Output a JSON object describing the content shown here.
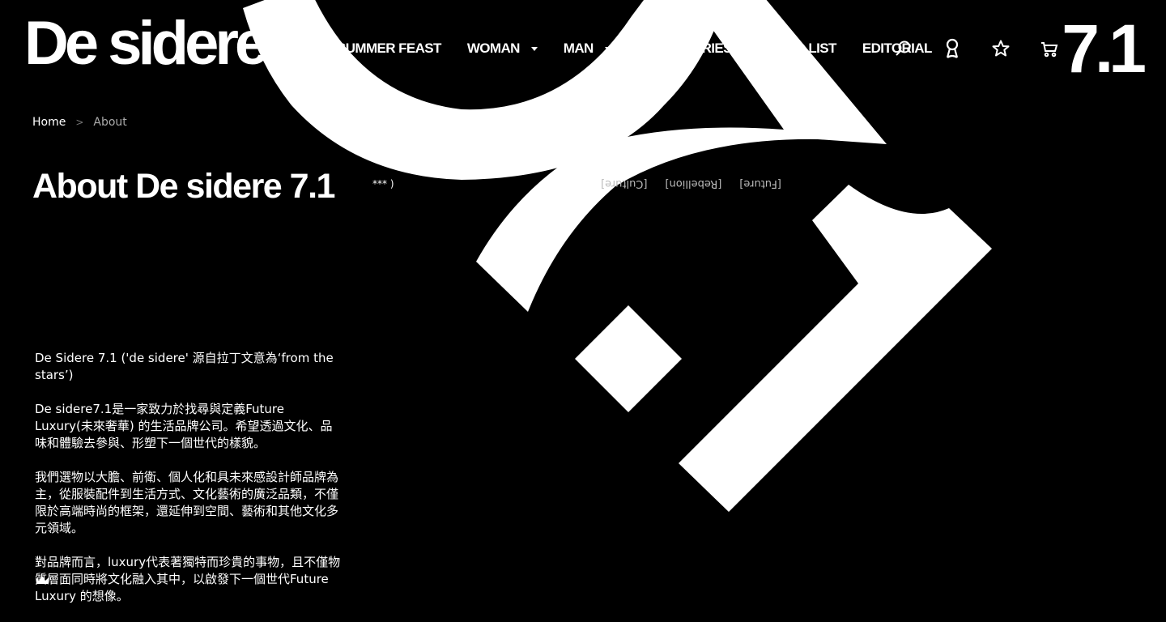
{
  "header": {
    "logo": "De sidere",
    "nav": [
      {
        "label": "SUMMER FEAST",
        "dropdown": false
      },
      {
        "label": "WOMAN",
        "dropdown": true
      },
      {
        "label": "MAN",
        "dropdown": true
      },
      {
        "label": "ACCESSORIES",
        "dropdown": false
      },
      {
        "label": "BRAND LIST",
        "dropdown": false
      },
      {
        "label": "EDITORIAL",
        "dropdown": false
      }
    ],
    "icons": [
      "search-icon",
      "account-icon",
      "wishlist-star-icon",
      "cart-icon"
    ],
    "brand_mark": "7.1"
  },
  "breadcrumb": {
    "home": "Home",
    "separator": ">",
    "current": "About"
  },
  "page": {
    "title": "About De sidere 7.1",
    "marquee_stars": "*** )",
    "marquee_words": [
      "[Future]",
      "[Rebellion]",
      "[Culture]"
    ]
  },
  "content": {
    "p1": "De Sidere 7.1 ('de sidere' 源自拉丁文意為‘from the stars’)",
    "p2": "De sidere7.1是一家致力於找尋與定義Future Luxury(未來奢華) 的生活品牌公司。希望透過文化、品味和體驗去參與、形塑下一個世代的樣貌。",
    "p3": "我們選物以大膽、前衛、個人化和具未來感設計師品牌為主，從服裝配件到生活方式、文化藝術的廣泛品類，不僅限於高端時尚的框架，還延伸到空間、藝術和其他文化多元領域。",
    "p4": "對品牌而言，luxury代表著獨特而珍貴的事物，且不僅物質層面同時將文化融入其中，以啟發下一個世代Future Luxury 的想像。"
  },
  "colors": {
    "background": "#000000",
    "foreground": "#ffffff",
    "muted": "#aaaaaa"
  }
}
